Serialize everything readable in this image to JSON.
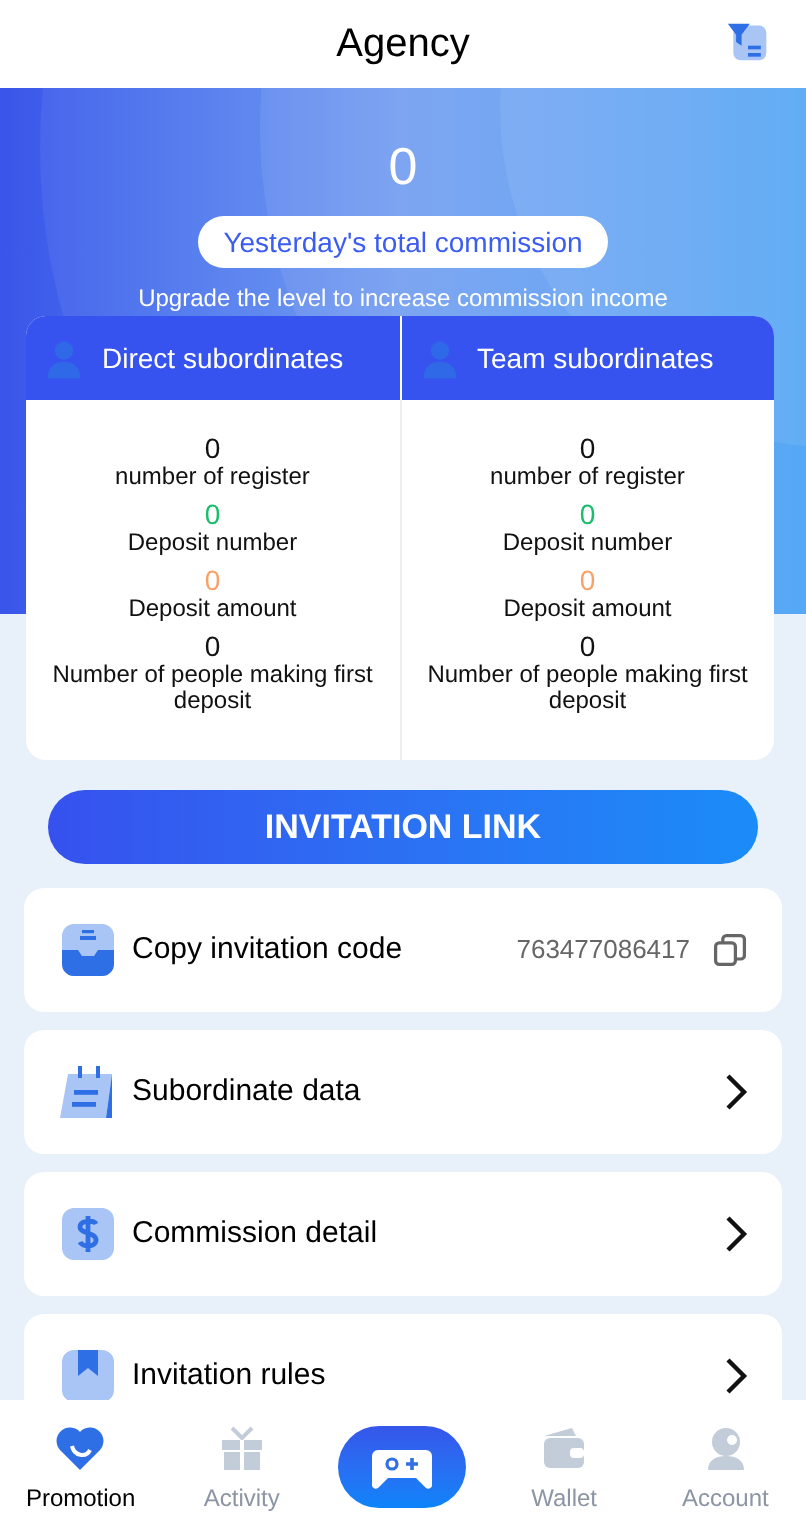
{
  "header": {
    "title": "Agency"
  },
  "hero": {
    "amount": "0",
    "label": "Yesterday's total commission",
    "note": "Upgrade the level to increase commission income"
  },
  "panels": [
    {
      "title": "Direct subordinates",
      "stats": [
        {
          "value": "0",
          "label": "number of register",
          "color": "#111111"
        },
        {
          "value": "0",
          "label": "Deposit number",
          "color": "#19be6b"
        },
        {
          "value": "0",
          "label": "Deposit amount",
          "color": "#f7a26a"
        },
        {
          "value": "0",
          "label": "Number of people making first deposit",
          "color": "#111111"
        }
      ]
    },
    {
      "title": "Team subordinates",
      "stats": [
        {
          "value": "0",
          "label": "number of register",
          "color": "#111111"
        },
        {
          "value": "0",
          "label": "Deposit number",
          "color": "#19be6b"
        },
        {
          "value": "0",
          "label": "Deposit amount",
          "color": "#f7a26a"
        },
        {
          "value": "0",
          "label": "Number of people making first deposit",
          "color": "#111111"
        }
      ]
    }
  ],
  "invite_button": "INVITATION LINK",
  "menu": [
    {
      "kind": "copy",
      "label": "Copy invitation code",
      "value": "763477086417"
    },
    {
      "kind": "link",
      "label": "Subordinate data"
    },
    {
      "kind": "link",
      "label": "Commission detail"
    },
    {
      "kind": "link",
      "label": "Invitation rules"
    }
  ],
  "tabs": [
    {
      "label": "Promotion",
      "selected": true
    },
    {
      "label": "Activity",
      "selected": false
    },
    {
      "kind": "center",
      "selected": false
    },
    {
      "label": "Wallet",
      "selected": false
    },
    {
      "label": "Account",
      "selected": false
    }
  ]
}
